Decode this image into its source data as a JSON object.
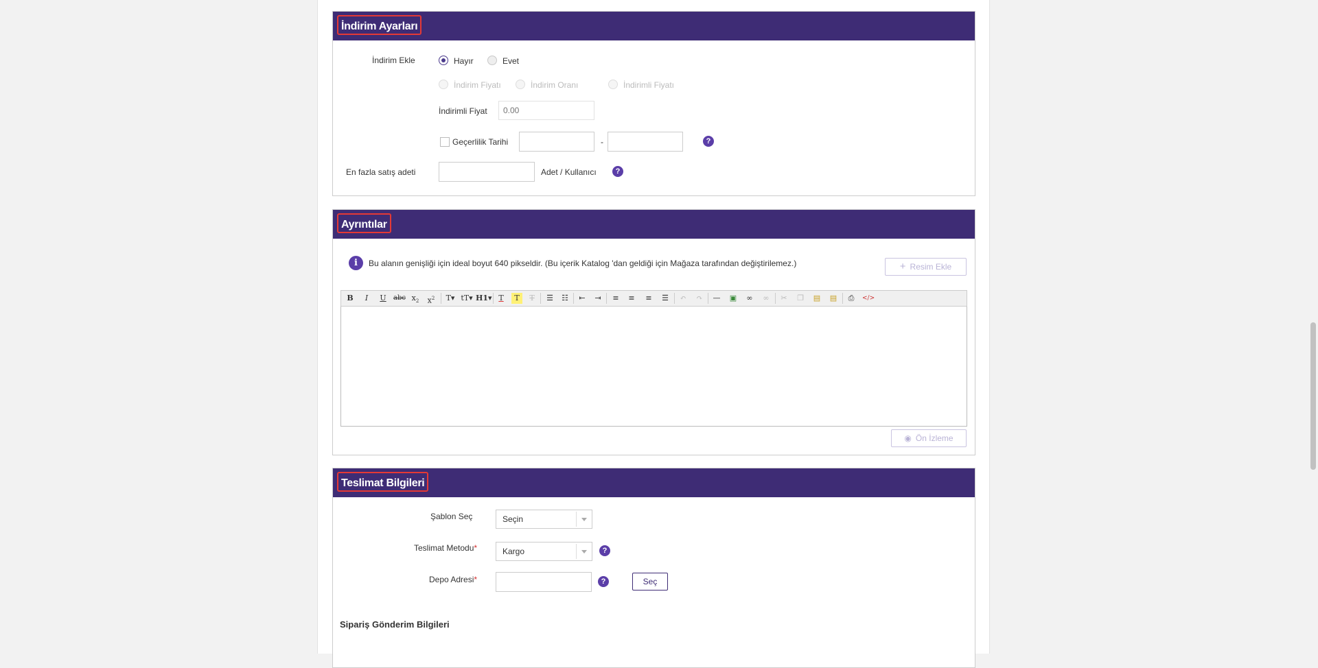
{
  "discount": {
    "title": "İndirim Ayarları",
    "add_label": "İndirim Ekle",
    "no_label": "Hayır",
    "yes_label": "Evet",
    "type_price": "İndirim Fiyatı",
    "type_rate": "İndirim Oranı",
    "type_discounted": "İndirimli Fiyatı",
    "discounted_price_label": "İndirimli Fiyat",
    "discounted_price_placeholder": "0.00",
    "validity_label": "Geçerlilik Tarihi",
    "date_separator": "-",
    "max_sale_label": "En fazla satış adeti",
    "max_sale_unit": "Adet / Kullanıcı"
  },
  "details": {
    "title": "Ayrıntılar",
    "info_text": "Bu alanın genişliği için ideal boyut 640 pikseldir. (Bu içerik Katalog 'dan geldiği için Mağaza tarafından değiştirilemez.)",
    "add_image_label": "Resim Ekle",
    "preview_label": "Ön İzleme"
  },
  "delivery": {
    "title": "Teslimat Bilgileri",
    "template_label": "Şablon Seç",
    "template_value": "Seçin",
    "method_label": "Teslimat Metodu",
    "method_value": "Kargo",
    "warehouse_label": "Depo Adresi",
    "select_button": "Seç",
    "required_mark": "*",
    "order_shipping_heading": "Sipariş Gönderim Bilgileri"
  },
  "help_glyph": "?",
  "info_glyph": "i",
  "colors": {
    "header": "#3e2c75",
    "accent": "#5b3ea8",
    "highlight_border": "#e53935"
  }
}
